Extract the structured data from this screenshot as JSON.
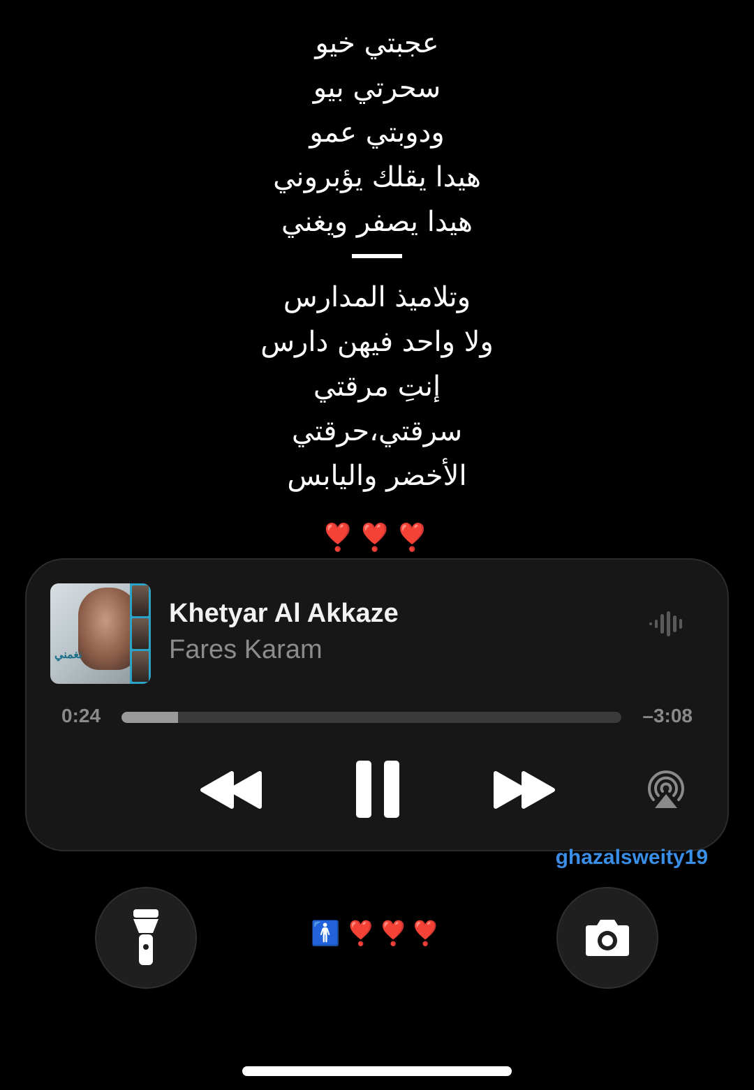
{
  "lyrics": {
    "block1": [
      "عجبتي خيو",
      "سحرتي بيو",
      "ودوبتي عمو",
      "هيدا يقلك يؤبروني",
      "هيدا يصفر ويغني"
    ],
    "block2": [
      "وتلاميذ المدارس",
      "ولا واحد فيهن دارس",
      "إنتِ مرقتي",
      "سرقتي،حرقتي",
      "الأخضر واليابس"
    ],
    "hearts": "❣️❣️❣️"
  },
  "now_playing": {
    "title": "Khetyar Al Akkaze",
    "artist": "Fares Karam",
    "artwork_label": "نغمني",
    "elapsed": "0:24",
    "remaining": "–3:08",
    "progress": 0.113,
    "controls": {
      "rewind_icon": "rewind-icon",
      "pause_icon": "pause-icon",
      "forward_icon": "fast-forward-icon",
      "airplay_icon": "airplay-audio-icon",
      "waveform_icon": "waveform-icon"
    }
  },
  "watermark": "ghazalsweity19",
  "lockscreen": {
    "left_button_icon": "flashlight-icon",
    "right_button_icon": "camera-icon",
    "center_person": "🚹",
    "center_hearts": "❣️❣️❣️"
  },
  "colors": {
    "background": "#000000",
    "card": "#171717",
    "accent_watermark": "#3a8ee6",
    "heart": "#d8142c"
  }
}
